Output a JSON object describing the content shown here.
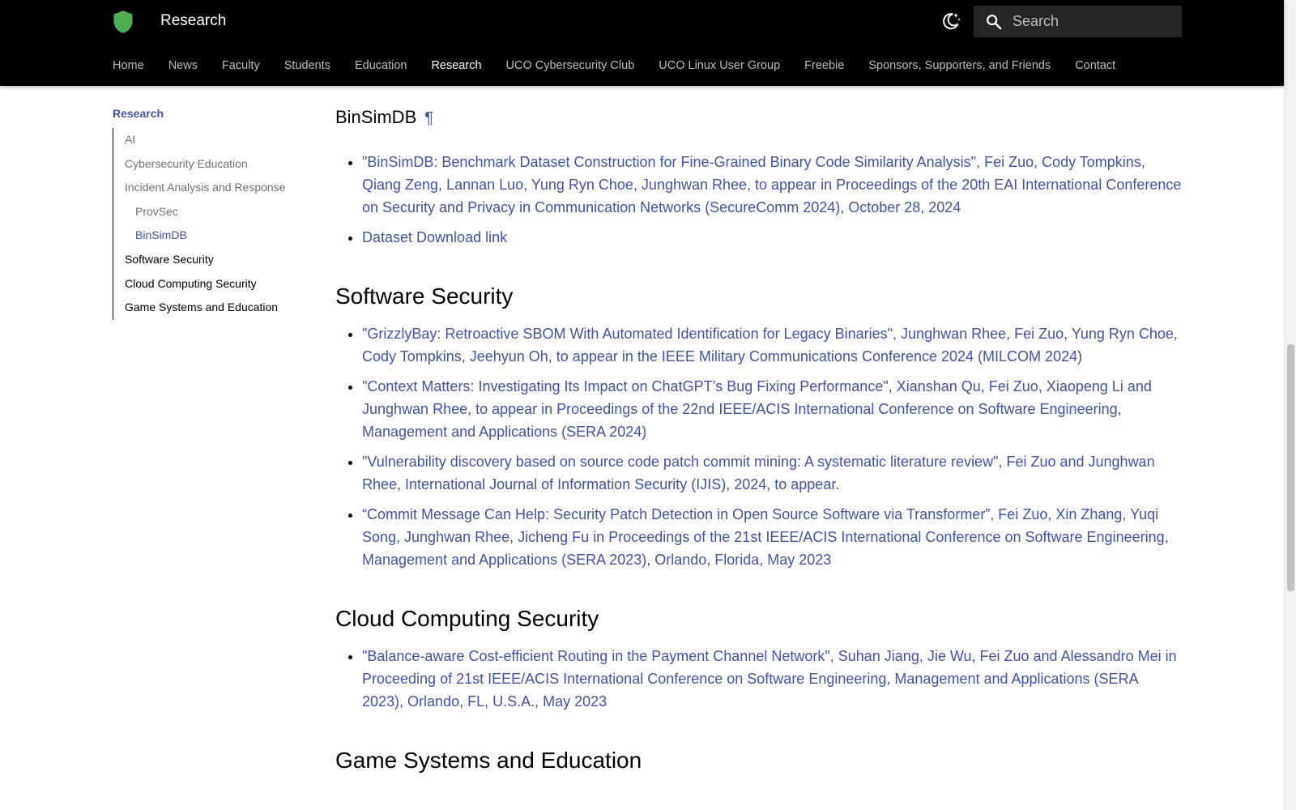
{
  "header": {
    "title": "Research",
    "search_placeholder": "Search"
  },
  "tabs": [
    "Home",
    "News",
    "Faculty",
    "Students",
    "Education",
    "Research",
    "UCO Cybersecurity Club",
    "UCO Linux User Group",
    "Freebie",
    "Sponsors, Supporters, and Friends",
    "Contact"
  ],
  "sidebar": {
    "title": "Research",
    "items": [
      {
        "label": "AI"
      },
      {
        "label": "Cybersecurity Education"
      },
      {
        "label": "Incident Analysis and Response"
      },
      {
        "label": "ProvSec"
      },
      {
        "label": "BinSimDB"
      },
      {
        "label": "Software Security"
      },
      {
        "label": "Cloud Computing Security"
      },
      {
        "label": "Game Systems and Education"
      }
    ]
  },
  "sections": {
    "binsimdb": {
      "heading": "BinSimDB",
      "anchor": "¶",
      "refs": [
        "\"BinSimDB: Benchmark Dataset Construction for Fine-Grained Binary Code Similarity Analysis\", Fei Zuo, Cody Tompkins, Qiang Zeng, Lannan Luo, Yung Ryn Choe, Junghwan Rhee, to appear in Proceedings of the 20th EAI International Conference on Security and Privacy in Communication Networks (SecureComm 2024), October 28, 2024",
        "Dataset Download link"
      ]
    },
    "software": {
      "heading": "Software Security",
      "refs": [
        "\"GrizzlyBay: Retroactive SBOM With Automated Identification for Legacy Binaries\", Junghwan Rhee, Fei Zuo, Yung Ryn Choe, Cody Tompkins, Jeehyun Oh, to appear in the IEEE Military Communications Conference 2024 (MILCOM 2024)",
        "\"Context Matters: Investigating Its Impact on ChatGPT’s Bug Fixing Performance\", Xianshan Qu, Fei Zuo, Xiaopeng Li and Junghwan Rhee, to appear in Proceedings of the 22nd IEEE/ACIS International Conference on Software Engineering, Management and Applications (SERA 2024)",
        "\"Vulnerability discovery based on source code patch commit mining: A systematic literature review\", Fei Zuo and Junghwan Rhee, International Journal of Information Security (IJIS), 2024, to appear.",
        "“Commit Message Can Help: Security Patch Detection in Open Source Software via Transformer”, Fei Zuo, Xin Zhang, Yuqi Song, Junghwan Rhee, Jicheng Fu in Proceedings of the 21st IEEE/ACIS International Conference on Software Engineering, Management and Applications (SERA 2023), Orlando, Florida, May 2023"
      ]
    },
    "cloud": {
      "heading": "Cloud Computing Security",
      "refs": [
        "\"Balance-aware Cost-efficient Routing in the Payment Channel Network\", Suhan Jiang, Jie Wu, Fei Zuo and Alessandro Mei in Proceeding of 21st IEEE/ACIS International Conference on Software Engineering, Management and Applications (SERA 2023), Orlando, FL, U.S.A., May 2023"
      ]
    },
    "game": {
      "heading": "Game Systems and Education"
    }
  },
  "colors": {
    "header_bg": "#000000",
    "link": "#4051b5",
    "logo": "#4caf50"
  }
}
